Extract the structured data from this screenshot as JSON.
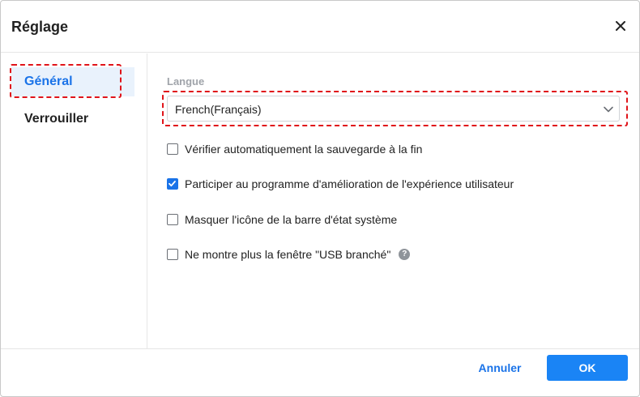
{
  "window": {
    "title": "Réglage",
    "close_icon": "close-icon"
  },
  "sidebar": {
    "items": [
      {
        "label": "Général",
        "active": true
      },
      {
        "label": "Verrouiller",
        "active": false
      }
    ]
  },
  "main": {
    "language_label": "Langue",
    "language_select": {
      "value": "French(Français)",
      "icon": "chevron-down-icon"
    },
    "options": [
      {
        "label": "Vérifier automatiquement la sauvegarde à la fin",
        "checked": false
      },
      {
        "label": "Participer au programme d'amélioration de l'expérience utilisateur",
        "checked": true
      },
      {
        "label": "Masquer l'icône de la barre d'état système",
        "checked": false
      },
      {
        "label": "Ne montre plus la fenêtre \"USB branché\"",
        "checked": false,
        "help_icon": "?"
      }
    ]
  },
  "footer": {
    "cancel_label": "Annuler",
    "ok_label": "OK"
  },
  "colors": {
    "accent": "#1a73e8",
    "ok_button": "#1a84f5",
    "active_nav_bg": "#e9f2fc",
    "highlight_dashed": "#e0141a"
  }
}
